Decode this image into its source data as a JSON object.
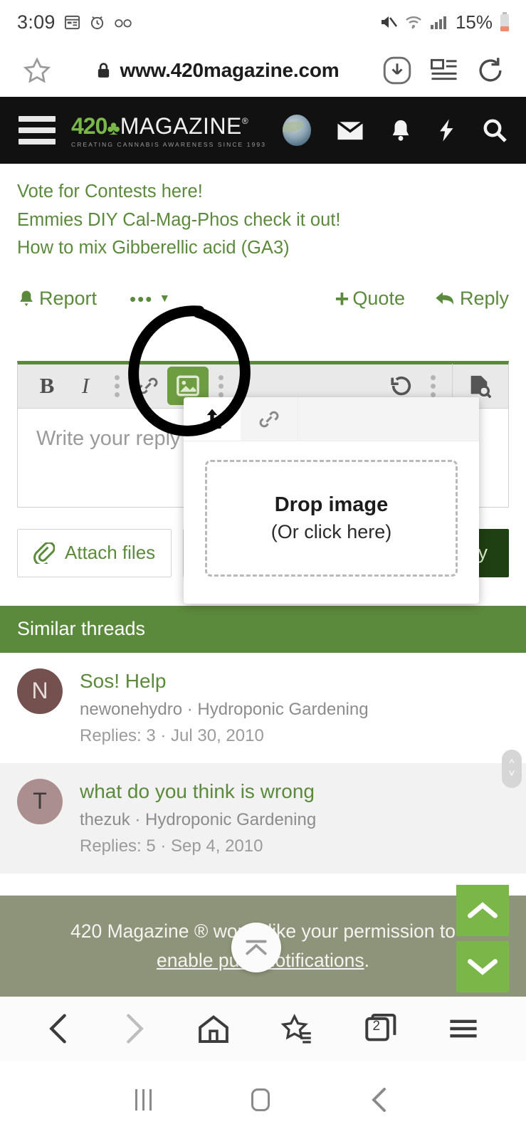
{
  "status_bar": {
    "time": "3:09",
    "left_icons": [
      "calendar-icon",
      "alarm-icon",
      "voicemail-icon"
    ],
    "right_icons": [
      "mute-icon",
      "wifi-icon",
      "signal-icon"
    ],
    "battery_percent": "15%"
  },
  "browser_url_bar": {
    "url": "www.420magazine.com",
    "secure": true,
    "icons": [
      "bookmark-star-icon",
      "lock-icon",
      "download-icon",
      "reader-view-icon",
      "reload-icon"
    ]
  },
  "site_header": {
    "logo_number": "420",
    "logo_word": "MAGAZINE",
    "logo_registered": "®",
    "logo_tagline": "CREATING CANNABIS AWARENESS SINCE 1993",
    "icons": [
      "hamburger-menu-icon",
      "avatar",
      "inbox-envelope-icon",
      "alerts-bell-icon",
      "whats-new-bolt-icon",
      "search-icon"
    ],
    "accent_green": "#7ab648",
    "background": "#111111"
  },
  "post_links": [
    "Vote for Contests here!",
    "Emmies DIY Cal-Mag-Phos check it out!",
    "How to mix Gibberellic acid (GA3)"
  ],
  "action_row": {
    "report_label": "Report",
    "more_dots": "•••",
    "quote_label": "Quote",
    "quote_plus": "+",
    "reply_label": "Reply"
  },
  "editor": {
    "accent_top_border": "#5c8a3c",
    "toolbar": {
      "bold_label": "B",
      "italic_label": "I",
      "buttons": [
        "bold-button",
        "italic-button",
        "more-dots",
        "link-button",
        "insert-image-button",
        "more-dots",
        "undo-button",
        "more-dots",
        "preview-button"
      ],
      "active_button": "insert-image-button",
      "active_background": "#6d9c41"
    },
    "placeholder": "Write your reply",
    "attach_files_label": "Attach files",
    "quote_button_icon": "quote-icon",
    "submit_label": "Reply",
    "submit_visible_text": "y",
    "submit_background": "#1f4012"
  },
  "image_popup": {
    "tabs": [
      {
        "name": "upload-tab",
        "icon": "upload-icon",
        "active": true
      },
      {
        "name": "url-tab",
        "icon": "link-icon",
        "active": false
      }
    ],
    "dropzone_title": "Drop image",
    "dropzone_subtitle": "(Or click here)"
  },
  "annotation": {
    "type": "hand-drawn-circle",
    "color": "#000000",
    "target": "insert-image-button"
  },
  "similar_threads": {
    "heading": "Similar threads",
    "heading_background": "#5c8a3c",
    "items": [
      {
        "avatar_letter": "N",
        "avatar_color": "#74514f",
        "title": "Sos! Help",
        "meta": "newonehydro · Hydroponic Gardening",
        "replies": "Replies: 3 · Jul 30, 2010"
      },
      {
        "avatar_letter": "T",
        "avatar_color": "#ab8f8f",
        "title": "what do you think is wrong",
        "meta": "thezuk · Hydroponic Gardening",
        "replies": "Replies: 5 · Sep 4, 2010"
      }
    ]
  },
  "push_banner": {
    "text_before": "420 Magazine ® would like your permission to ",
    "link_text": "enable push notifications",
    "text_after": ".",
    "background": "#8d9479"
  },
  "scroll_controls": {
    "up_icon": "chevron-up-icon",
    "down_icon": "chevron-down-icon",
    "button_color": "#7ab648",
    "scroll_to_top_icon": "scroll-to-top-icon",
    "nub_icon": "scroll-nub-icon"
  },
  "browser_bottom_bar": {
    "items": [
      "back-button",
      "forward-button",
      "home-button",
      "bookmarks-button",
      "tabs-button",
      "browser-menu-button"
    ],
    "back_enabled": true,
    "forward_enabled": false,
    "tab_count": "2"
  },
  "android_nav_bar": {
    "items": [
      "recents-button",
      "home-button",
      "back-button"
    ]
  }
}
